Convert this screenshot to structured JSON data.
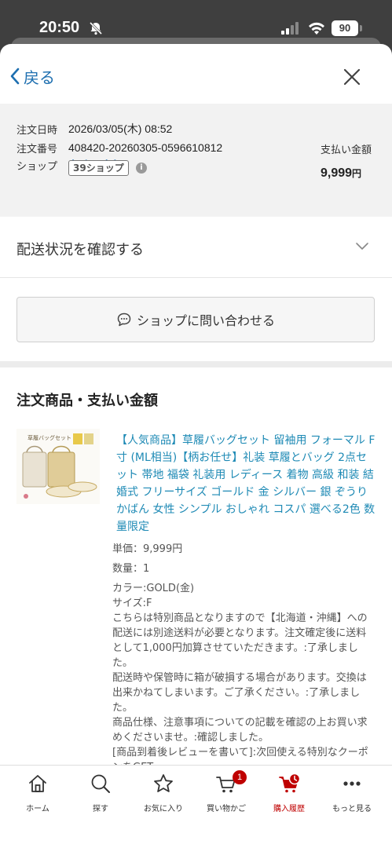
{
  "status_bar": {
    "time": "20:50",
    "battery": "90"
  },
  "nav": {
    "back_label": "戻る"
  },
  "order": {
    "date_label": "注文日時",
    "date_value": "2026/03/05(木) 08:52",
    "number_label": "注文番号",
    "number_value": "408420-20260305-0596610812",
    "shop_label": "ショップ",
    "shop_name": "あめてまり",
    "shop_badge": "39ショップ",
    "payment_label": "支払い金額",
    "payment_amount": "9,999",
    "payment_unit": "円"
  },
  "shipping": {
    "label": "配送状況を確認する"
  },
  "contact": {
    "label": "ショップに問い合わせる"
  },
  "section": {
    "title": "注文商品・支払い金額"
  },
  "product": {
    "title": "【人気商品】草履バッグセット 留袖用 フォーマル F寸 (ML相当)【柄お任せ】礼装 草履とバッグ 2点セット 帯地 福袋 礼装用 レディース 着物 高級 和装 結婚式 フリーサイズ ゴールド 金 シルバー 銀 ぞうり かばん 女性 シンプル おしゃれ コスパ 選べる2色 数量限定",
    "image_caption": "草履バッグセット",
    "unit_price": "単価：9,999円",
    "quantity": "数量：1",
    "color": "カラー:GOLD(金)",
    "size": "サイズ:F",
    "note1": "こちらは特別商品となりますので【北海道・沖縄】への配送には別途送料が必要となります。注文確定後に送料として1,000円加算させていただきます。:了承しました。",
    "note2": "配送時や保管時に箱が破損する場合があります。交換は出来かねてしまいます。ご了承ください。:了承しました。",
    "note3": "商品仕様、注意事項についての記載を確認の上お買い求めくださいませ。:確認しました。",
    "note4": "[商品到着後レビューを書いて]:次回使える特別なクーポンをGET"
  },
  "tabs": [
    {
      "label": "ホーム",
      "icon": "home-icon"
    },
    {
      "label": "探す",
      "icon": "search-icon"
    },
    {
      "label": "お気に入り",
      "icon": "star-icon"
    },
    {
      "label": "買い物かご",
      "icon": "cart-icon",
      "badge": "1"
    },
    {
      "label": "購入履歴",
      "icon": "purchase-history-icon",
      "active": true
    },
    {
      "label": "もっと見る",
      "icon": "more-icon"
    }
  ],
  "colors": {
    "link": "#1e6fb0",
    "product_link": "#1e8ab5",
    "accent": "#bf0000"
  }
}
